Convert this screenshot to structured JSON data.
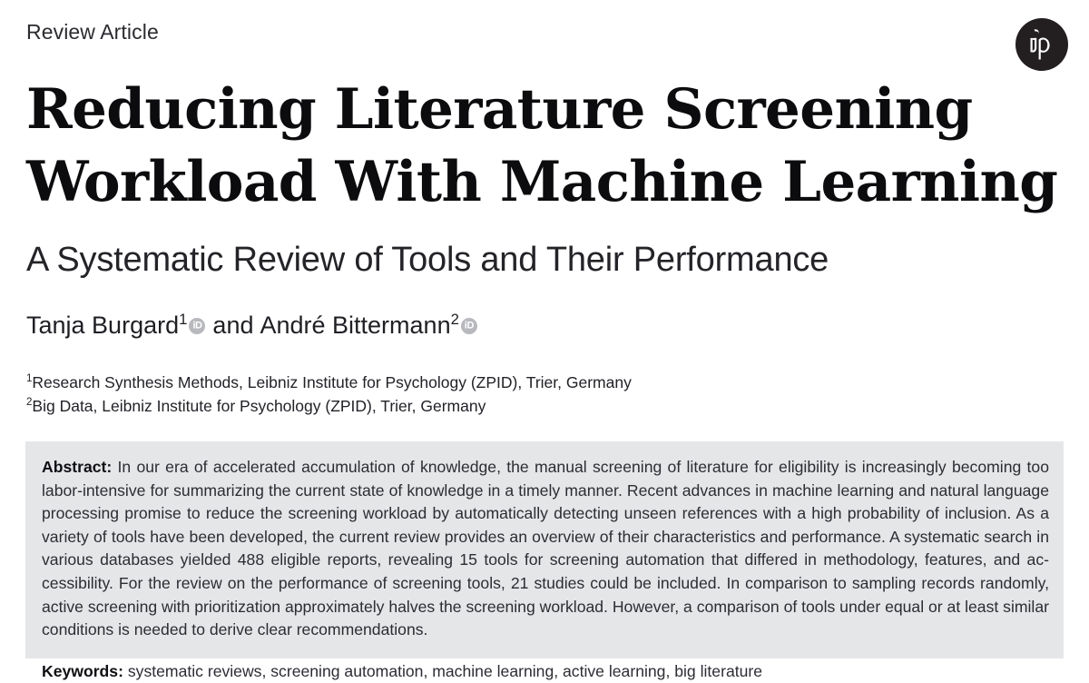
{
  "header": {
    "article_type": "Review Article",
    "logo_name": "hogrefe-publishing-logo",
    "logo_text": "hp"
  },
  "title": {
    "line1": "Reducing Literature Screening",
    "line2": "Workload With Machine Learning"
  },
  "subtitle": "A Systematic Review of Tools and Their Performance",
  "authors": {
    "author1_name": "Tanja Burgard",
    "author1_sup": "1",
    "conjunction": "and",
    "author2_name": "André Bittermann",
    "author2_sup": "2",
    "orcid_label": "iD"
  },
  "affiliations": {
    "aff1_sup": "1",
    "aff1_text": "Research Synthesis Methods, Leibniz Institute for Psychology (ZPID), Trier, Germany",
    "aff2_sup": "2",
    "aff2_text": "Big Data, Leibniz Institute for Psychology (ZPID), Trier, Germany"
  },
  "abstract": {
    "label": "Abstract:",
    "body": "In our era of accelerated accumulation of knowledge, the manual screening of literature for eligibility is increasingly becoming too labor-intensive for summarizing the current state of knowledge in a timely manner. Recent advances in machine learning and natural language processing promise to reduce the screening workload by automatically detecting unseen references with a high probability of inclusion. As a variety of tools have been developed, the current review provides an overview of their characteristics and performance. A systematic search in various databases yielded 488 eligible reports, revealing 15 tools for screening automation that differed in methodology, features, and ac-cessibility. For the review on the performance of screening tools, 21 studies could be included. In comparison to sampling records randomly, active screening with prioritization approximately halves the screening workload. However, a comparison of tools under equal or at least similar conditions is needed to derive clear recommendations."
  },
  "keywords": {
    "label": "Keywords:",
    "list": "systematic reviews, screening automation, machine learning, active learning, big literature"
  },
  "colors": {
    "abstract_background": "#E5E6E8",
    "text": "#2C2C33",
    "title": "#0C0C0F",
    "orcid_gray": "#B7B9BD",
    "logo_dark": "#231F20"
  }
}
